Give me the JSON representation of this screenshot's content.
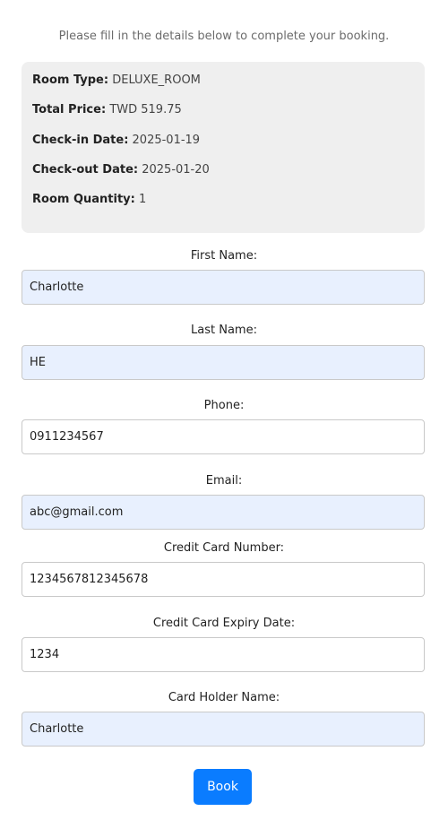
{
  "intro_text": "Please fill in the details below to complete your booking.",
  "summary": {
    "room_type_label": "Room Type:",
    "room_type_value": "DELUXE_ROOM",
    "total_price_label": "Total Price:",
    "total_price_value": "TWD 519.75",
    "check_in_label": "Check-in Date:",
    "check_in_value": "2025-01-19",
    "check_out_label": "Check-out Date:",
    "check_out_value": "2025-01-20",
    "room_quantity_label": "Room Quantity:",
    "room_quantity_value": "1"
  },
  "form": {
    "first_name": {
      "label": "First Name:",
      "value": "Charlotte"
    },
    "last_name": {
      "label": "Last Name:",
      "value": "HE"
    },
    "phone": {
      "label": "Phone:",
      "value": "0911234567"
    },
    "email": {
      "label": "Email:",
      "value": "abc@gmail.com"
    },
    "card_number": {
      "label": "Credit Card Number:",
      "value": "1234567812345678"
    },
    "card_expiry": {
      "label": "Credit Card Expiry Date:",
      "value": "1234"
    },
    "card_holder": {
      "label": "Card Holder Name:",
      "value": "Charlotte"
    }
  },
  "book_button_label": "Book",
  "colors": {
    "summary_bg": "#efefef",
    "autofill_bg": "#e8f0fe",
    "primary": "#0a7cff"
  }
}
